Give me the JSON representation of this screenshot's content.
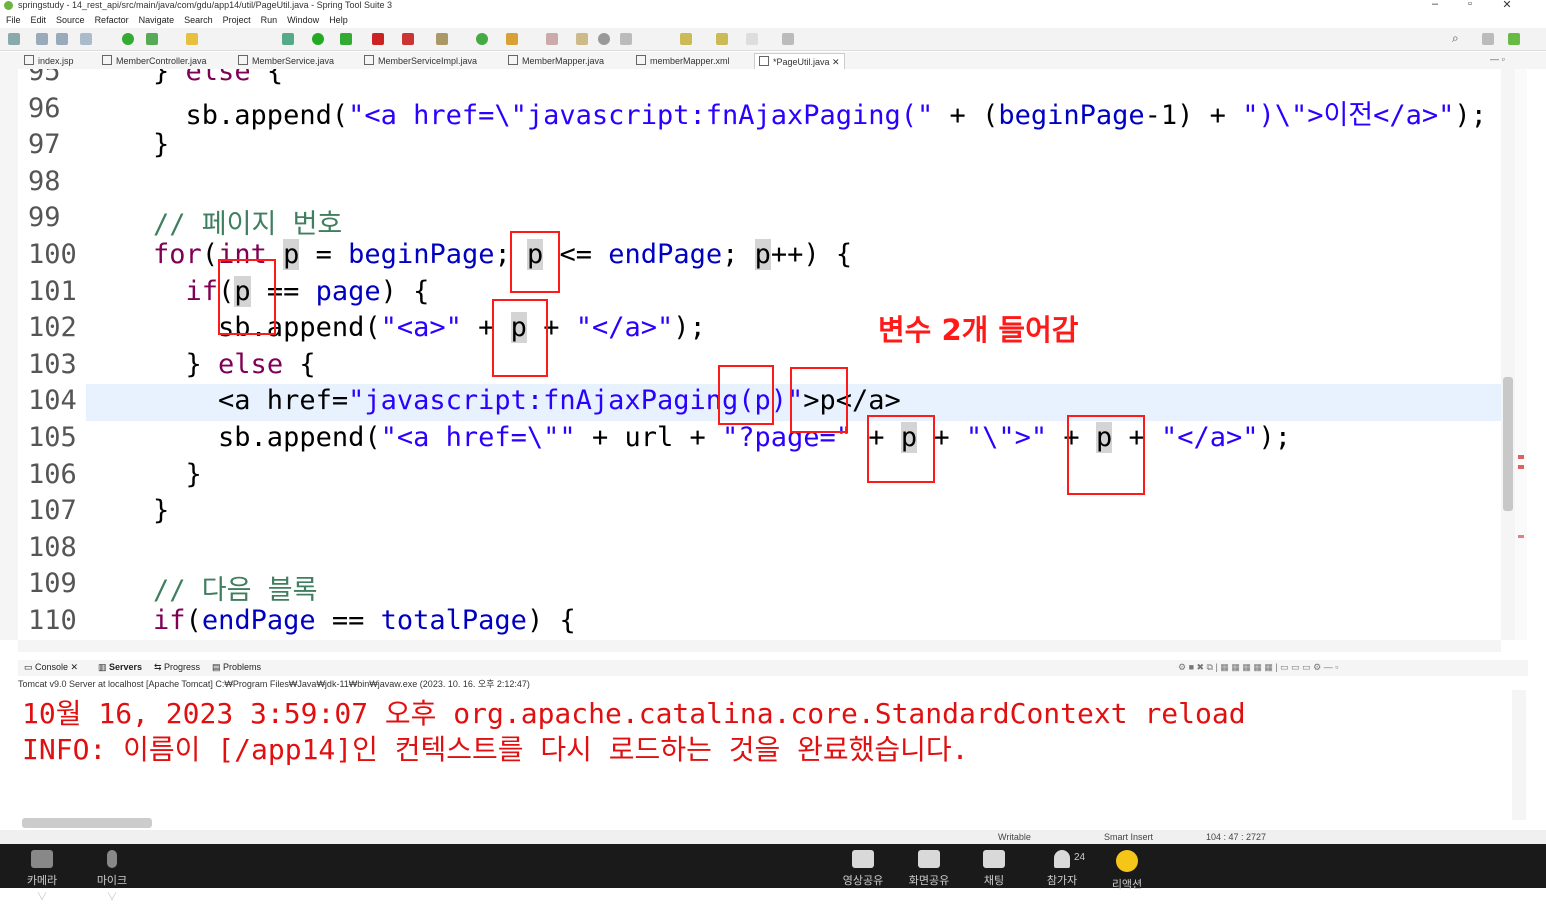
{
  "window": {
    "title": "springstudy - 14_rest_api/src/main/java/com/gdu/app14/util/PageUtil.java - Spring Tool Suite 3"
  },
  "menu": [
    "File",
    "Edit",
    "Source",
    "Refactor",
    "Navigate",
    "Search",
    "Project",
    "Run",
    "Window",
    "Help"
  ],
  "tabs": [
    "index.jsp",
    "MemberController.java",
    "MemberService.java",
    "MemberServiceImpl.java",
    "MemberMapper.java",
    "memberMapper.xml",
    "*PageUtil.java"
  ],
  "editor": {
    "lines": [
      {
        "n": "95",
        "segs": [
          {
            "t": "    } ",
            "c": ""
          },
          {
            "t": "else",
            "c": "kw"
          },
          {
            "t": " {",
            "c": ""
          }
        ]
      },
      {
        "n": "96",
        "segs": [
          {
            "t": "      sb.append(",
            "c": ""
          },
          {
            "t": "\"<a href=\\\"javascript:fnAjaxPaging(\"",
            "c": "str"
          },
          {
            "t": " + (",
            "c": ""
          },
          {
            "t": "beginPage",
            "c": "var"
          },
          {
            "t": "-1) + ",
            "c": ""
          },
          {
            "t": "\")\\\">이전</a>\"",
            "c": "str"
          },
          {
            "t": ");",
            "c": ""
          }
        ]
      },
      {
        "n": "97",
        "segs": [
          {
            "t": "    }",
            "c": ""
          }
        ]
      },
      {
        "n": "98",
        "segs": [
          {
            "t": "",
            "c": ""
          }
        ]
      },
      {
        "n": "99",
        "segs": [
          {
            "t": "    // 페이지 번호",
            "c": "cm"
          }
        ]
      },
      {
        "n": "100",
        "segs": [
          {
            "t": "    ",
            "c": ""
          },
          {
            "t": "for",
            "c": "kw"
          },
          {
            "t": "(",
            "c": ""
          },
          {
            "t": "int",
            "c": "kw"
          },
          {
            "t": " ",
            "c": ""
          },
          {
            "t": "p",
            "c": "hlp"
          },
          {
            "t": " = ",
            "c": ""
          },
          {
            "t": "beginPage",
            "c": "var"
          },
          {
            "t": "; ",
            "c": ""
          },
          {
            "t": "p",
            "c": "hlp"
          },
          {
            "t": " <= ",
            "c": ""
          },
          {
            "t": "endPage",
            "c": "var"
          },
          {
            "t": "; ",
            "c": ""
          },
          {
            "t": "p",
            "c": "hlp"
          },
          {
            "t": "++) {",
            "c": ""
          }
        ]
      },
      {
        "n": "101",
        "segs": [
          {
            "t": "      ",
            "c": ""
          },
          {
            "t": "if",
            "c": "kw"
          },
          {
            "t": "(",
            "c": ""
          },
          {
            "t": "p",
            "c": "hlp"
          },
          {
            "t": " == ",
            "c": ""
          },
          {
            "t": "page",
            "c": "var"
          },
          {
            "t": ") {",
            "c": ""
          }
        ]
      },
      {
        "n": "102",
        "segs": [
          {
            "t": "        sb.append(",
            "c": ""
          },
          {
            "t": "\"<a>\"",
            "c": "str"
          },
          {
            "t": " + ",
            "c": ""
          },
          {
            "t": "p",
            "c": "hlp"
          },
          {
            "t": " + ",
            "c": ""
          },
          {
            "t": "\"</a>\"",
            "c": "str"
          },
          {
            "t": ");",
            "c": ""
          }
        ]
      },
      {
        "n": "103",
        "segs": [
          {
            "t": "      } ",
            "c": ""
          },
          {
            "t": "else",
            "c": "kw"
          },
          {
            "t": " {",
            "c": ""
          }
        ]
      },
      {
        "n": "104",
        "segs": [
          {
            "t": "        <a href=",
            "c": ""
          },
          {
            "t": "\"javascript:fnAjaxPaging(p)\"",
            "c": "str"
          },
          {
            "t": ">p</a>",
            "c": ""
          }
        ]
      },
      {
        "n": "105",
        "segs": [
          {
            "t": "        sb.append(",
            "c": ""
          },
          {
            "t": "\"<a href=\\\"\"",
            "c": "str"
          },
          {
            "t": " + url + ",
            "c": ""
          },
          {
            "t": "\"?page=\"",
            "c": "str"
          },
          {
            "t": " + ",
            "c": ""
          },
          {
            "t": "p",
            "c": "hlp"
          },
          {
            "t": " + ",
            "c": ""
          },
          {
            "t": "\"\\\">\"",
            "c": "str"
          },
          {
            "t": " + ",
            "c": ""
          },
          {
            "t": "p",
            "c": "hlp"
          },
          {
            "t": " + ",
            "c": ""
          },
          {
            "t": "\"</a>\"",
            "c": "str"
          },
          {
            "t": ");",
            "c": ""
          }
        ]
      },
      {
        "n": "106",
        "segs": [
          {
            "t": "      }",
            "c": ""
          }
        ]
      },
      {
        "n": "107",
        "segs": [
          {
            "t": "    }",
            "c": ""
          }
        ]
      },
      {
        "n": "108",
        "segs": [
          {
            "t": "",
            "c": ""
          }
        ]
      },
      {
        "n": "109",
        "segs": [
          {
            "t": "    // 다음 블록",
            "c": "cm"
          }
        ]
      },
      {
        "n": "110",
        "segs": [
          {
            "t": "    ",
            "c": ""
          },
          {
            "t": "if",
            "c": "kw"
          },
          {
            "t": "(",
            "c": ""
          },
          {
            "t": "endPage",
            "c": "var"
          },
          {
            "t": " == ",
            "c": ""
          },
          {
            "t": "totalPage",
            "c": "var"
          },
          {
            "t": ") {",
            "c": ""
          }
        ]
      }
    ],
    "annotation": "변수 2개 들어감"
  },
  "console": {
    "tabs": [
      "Console",
      "Servers",
      "Progress",
      "Problems"
    ],
    "header": "Tomcat v9.0 Server at localhost [Apache Tomcat] C:₩Program Files₩Java₩jdk-11₩bin₩javaw.exe  (2023. 10. 16. 오후 2:12:47)",
    "lines": [
      "10월 16, 2023 3:59:07 오후 org.apache.catalina.core.StandardContext reload",
      "INFO: 이름이 [/app14]인 컨텍스트를 다시 로드하는 것을 완료했습니다."
    ]
  },
  "status": {
    "mode": "Writable",
    "insert": "Smart Insert",
    "position": "104 : 47 : 2727"
  },
  "meeting": {
    "left": [
      {
        "label": "카메라 ∨",
        "icon": "camera-off-icon"
      },
      {
        "label": "마이크 ∨",
        "icon": "mic-off-icon"
      }
    ],
    "center": [
      {
        "label": "영상공유",
        "icon": "video-share-icon"
      },
      {
        "label": "화면공유",
        "icon": "screen-share-icon"
      },
      {
        "label": "채팅",
        "icon": "chat-icon"
      },
      {
        "label": "참가자",
        "icon": "participants-icon",
        "count": "24"
      },
      {
        "label": "리액션",
        "icon": "reaction-icon"
      }
    ]
  }
}
